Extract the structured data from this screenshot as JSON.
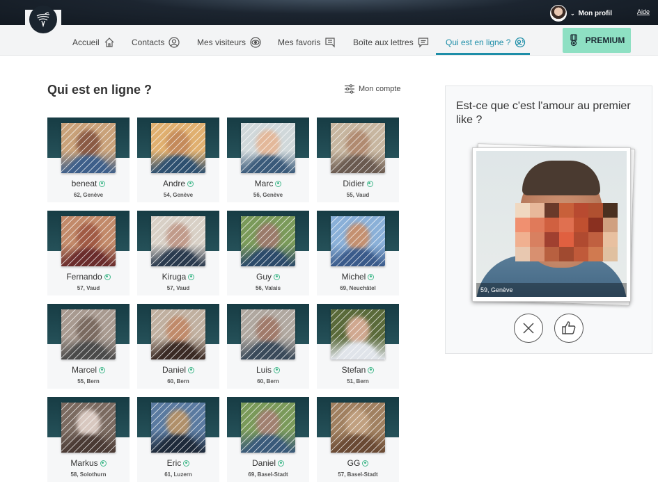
{
  "header": {
    "profile_label": "Mon profil",
    "help_label": "Aide"
  },
  "nav": {
    "items": [
      {
        "label": "Accueil",
        "icon": "home-icon"
      },
      {
        "label": "Contacts",
        "icon": "user-circle-icon"
      },
      {
        "label": "Mes visiteurs",
        "icon": "eye-icon"
      },
      {
        "label": "Mes favoris",
        "icon": "bookmark-icon"
      },
      {
        "label": "Boîte aux lettres",
        "icon": "chat-icon"
      },
      {
        "label": "Qui est en ligne ?",
        "icon": "online-icon"
      }
    ],
    "active": 5,
    "premium_label": "PREMIUM",
    "accent": "#1e8ea8",
    "premium_color": "#8ee0c3"
  },
  "main": {
    "title": "Qui est en ligne ?",
    "account_label": "Mon compte",
    "profiles": [
      {
        "name": "beneat",
        "info": "62, Genève"
      },
      {
        "name": "Andre",
        "info": "54, Genève"
      },
      {
        "name": "Marc",
        "info": "56, Genève"
      },
      {
        "name": "Didier",
        "info": "55, Vaud"
      },
      {
        "name": "Fernando",
        "info": "57, Vaud"
      },
      {
        "name": "Kiruga",
        "info": "57, Vaud"
      },
      {
        "name": "Guy",
        "info": "56, Valais"
      },
      {
        "name": "Michel",
        "info": "69, Neuchâtel"
      },
      {
        "name": "Marcel",
        "info": "55, Bern"
      },
      {
        "name": "Daniel",
        "info": "60, Bern"
      },
      {
        "name": "Luis",
        "info": "60, Bern"
      },
      {
        "name": "Stefan",
        "info": "51, Bern"
      },
      {
        "name": "Markus",
        "info": "58, Solothurn"
      },
      {
        "name": "Eric",
        "info": "61, Luzern"
      },
      {
        "name": "Daniel",
        "info": "69, Basel-Stadt"
      },
      {
        "name": "GG",
        "info": "57, Basel-Stadt"
      }
    ]
  },
  "panel": {
    "title": "Est-ce que c'est l'amour au premier like ?",
    "caption": "59, Genève",
    "dislike_icon": "close-icon",
    "like_icon": "thumbs-up-icon"
  }
}
